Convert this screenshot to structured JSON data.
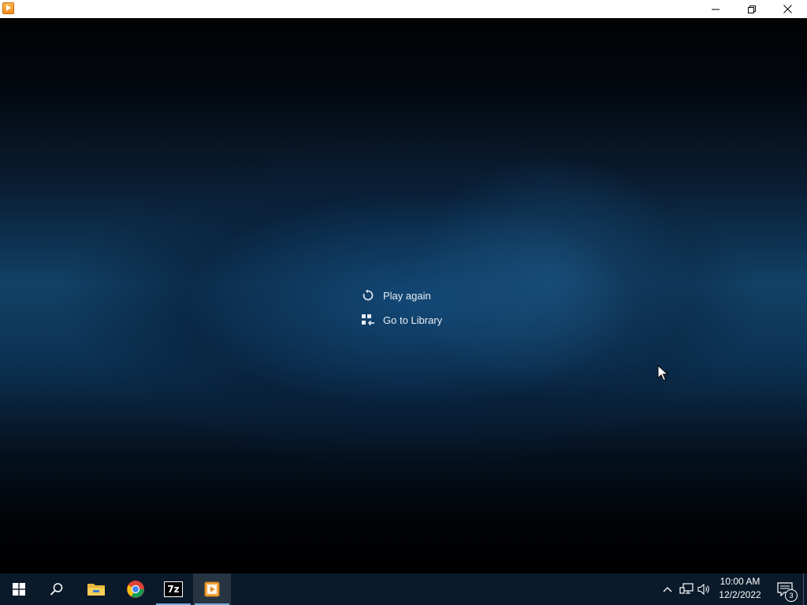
{
  "window": {
    "app_icon": "media-player-icon",
    "controls": [
      "minimize-icon",
      "restore-icon",
      "close-icon"
    ]
  },
  "end_menu": {
    "items": [
      {
        "label": "Play again",
        "icon": "replay-icon"
      },
      {
        "label": "Go to Library",
        "icon": "library-icon"
      }
    ]
  },
  "taskbar": {
    "apps": [
      {
        "name": "Start",
        "icon": "windows-logo-icon"
      },
      {
        "name": "Search",
        "icon": "search-icon"
      },
      {
        "name": "File Explorer",
        "icon": "folder-icon"
      },
      {
        "name": "Google Chrome",
        "icon": "chrome-icon"
      },
      {
        "name": "7-Zip",
        "icon": "7zip-icon",
        "icon_text": "7z"
      },
      {
        "name": "Media Player",
        "icon": "media-player-icon",
        "active": true
      }
    ],
    "tray": {
      "time": "10:00 AM",
      "date": "12/2/2022",
      "notification_count": "3"
    }
  },
  "colors": {
    "titlebar": "#ffffff",
    "taskbar": "#0a1a2a",
    "background_accent": "#114166",
    "menu_text": "#e6edf4"
  }
}
